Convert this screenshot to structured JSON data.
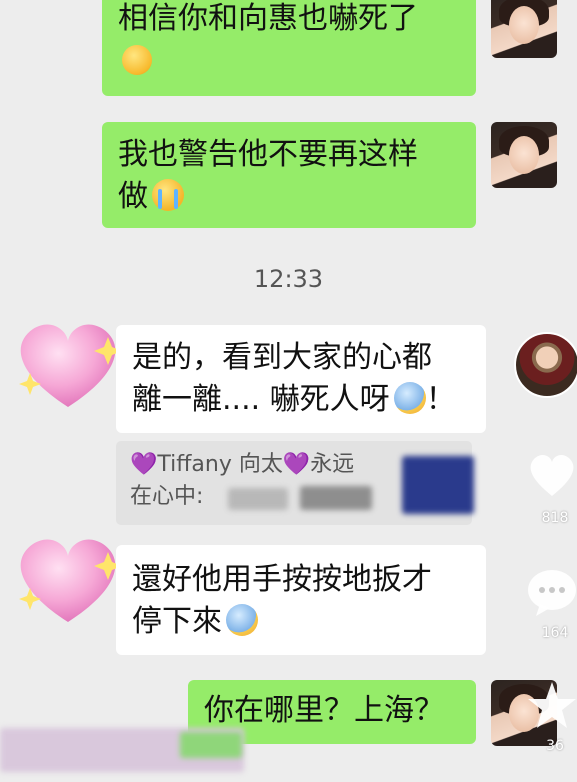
{
  "messages": [
    {
      "id": "m1",
      "text": "相信你和向惠也嚇死了"
    },
    {
      "id": "m2",
      "text1": "我也警告他不要再这样",
      "text2": "做"
    },
    {
      "id": "m3",
      "text1": "是的，看到大家的心都",
      "text2": "離一離.... 嚇死人呀",
      "text2_end": "！"
    },
    {
      "id": "m4",
      "text1": "還好他用手按按地扳才",
      "text2": "停下來"
    },
    {
      "id": "m5",
      "text": "你在哪里？上海？"
    }
  ],
  "timestamp": "12:33",
  "quote": {
    "line1": "💜Tiffany 向太💜永远",
    "line2": "在心中:"
  },
  "side_actions": {
    "likes": "818",
    "comments": "164",
    "favorites": "36"
  },
  "colors": {
    "sent_bubble": "#95ec69",
    "received_bubble": "#ffffff",
    "background": "#ededed"
  },
  "icons": [
    "mind-blown-emoji",
    "crying-emoji",
    "scream-emoji",
    "anxious-emoji",
    "heart-sticker",
    "like-heart-icon",
    "comment-icon",
    "star-icon"
  ]
}
